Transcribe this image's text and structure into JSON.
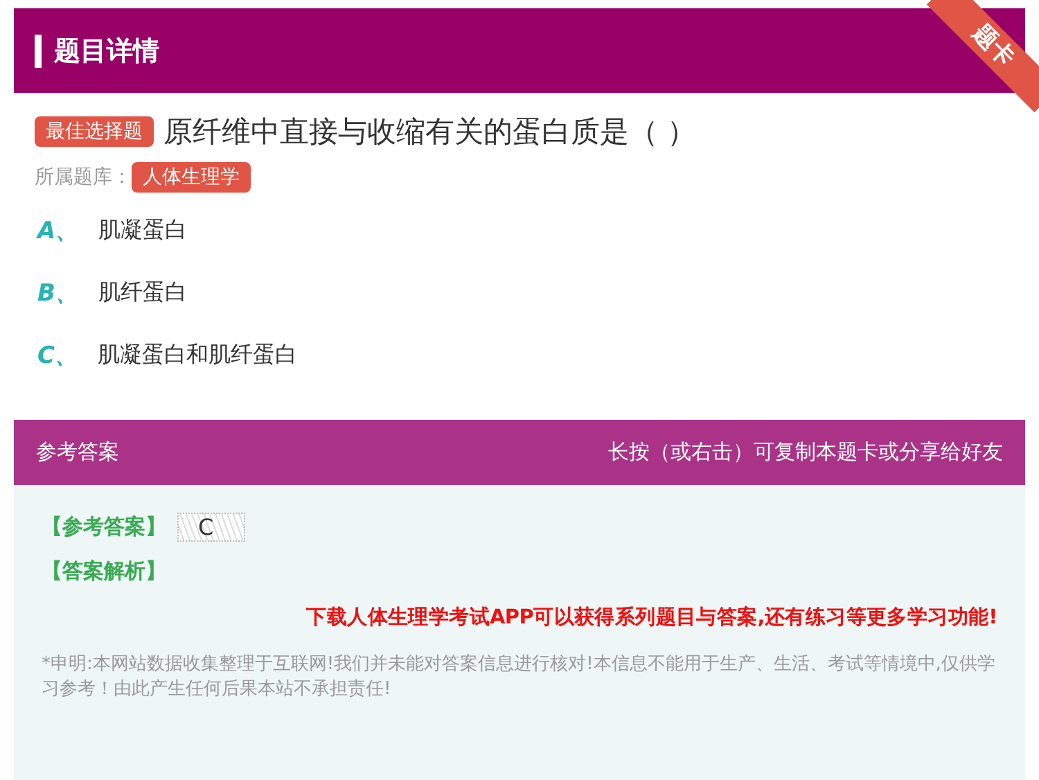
{
  "header": {
    "title": "题目详情",
    "ribbon": "题卡"
  },
  "question": {
    "type_badge": "最佳选择题",
    "text": "原纤维中直接与收缩有关的蛋白质是（  ）",
    "bank_label": "所属题库：",
    "bank": "人体生理学"
  },
  "options": [
    {
      "letter": "A、",
      "text": "肌凝蛋白"
    },
    {
      "letter": "B、",
      "text": "肌纤蛋白"
    },
    {
      "letter": "C、",
      "text": "肌凝蛋白和肌纤蛋白"
    }
  ],
  "answer_panel": {
    "title": "参考答案",
    "hint": "长按（或右击）可复制本题卡或分享给好友",
    "answer_label": "【参考答案】",
    "answer": "C",
    "analysis_label": "【答案解析】",
    "promo": "下载人体生理学考试APP可以获得系列题目与答案,还有练习等更多学习功能!",
    "disclaimer": "*申明:本网站数据收集整理于互联网!我们并未能对答案信息进行核对!本信息不能用于生产、生活、考试等情境中,仅供学习参考！由此产生任何后果本站不承担责任!"
  }
}
